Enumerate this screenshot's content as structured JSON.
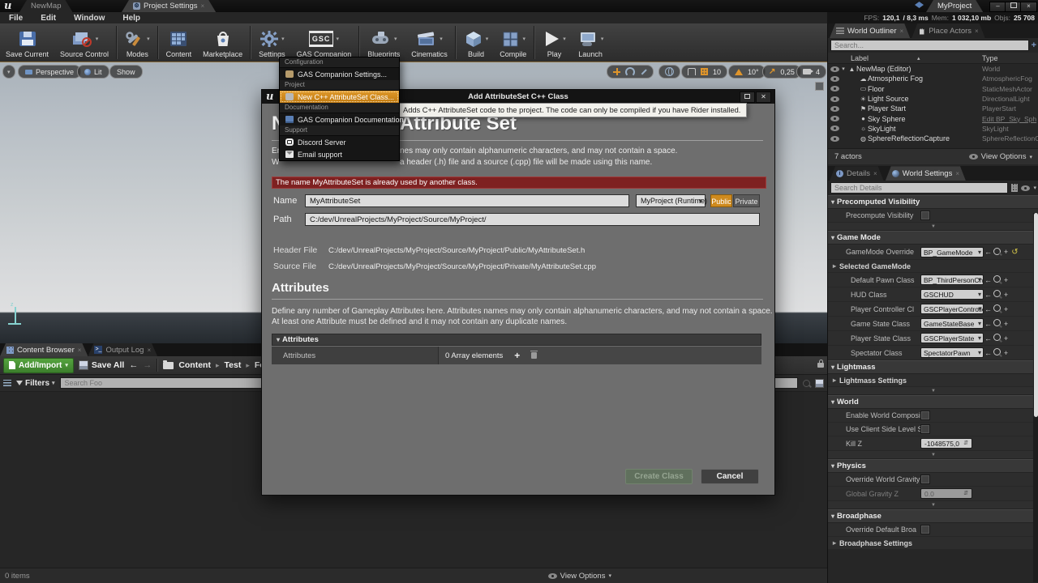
{
  "window": {
    "logo": "u",
    "tabs": [
      {
        "label": "NewMap"
      },
      {
        "label": "Project Settings"
      }
    ],
    "app_title": "MyProject",
    "menu_items": [
      "File",
      "Edit",
      "Window",
      "Help"
    ],
    "stats": {
      "fps_label": "FPS:",
      "fps_value": "120,1",
      "ms_value": "/ 8,3 ms",
      "mem_label": "Mem:",
      "mem_value": "1 032,10 mb",
      "objs_label": "Objs:",
      "objs_value": "25 708"
    }
  },
  "toolbar": {
    "buttons": [
      {
        "label": "Save Current"
      },
      {
        "label": "Source Control"
      },
      {
        "label": "Modes"
      },
      {
        "label": "Content"
      },
      {
        "label": "Marketplace"
      },
      {
        "label": "Settings"
      },
      {
        "label": "GAS Companion",
        "logo": "GSC"
      },
      {
        "label": "Blueprints"
      },
      {
        "label": "Cinematics"
      },
      {
        "label": "Build"
      },
      {
        "label": "Compile"
      },
      {
        "label": "Play"
      },
      {
        "label": "Launch"
      }
    ]
  },
  "viewport": {
    "perspective": "Perspective",
    "lit": "Lit",
    "show": "Show",
    "grid_snap": "10",
    "rotation_snap": "10°",
    "scale_snap": "0,25",
    "camera_speed": "4"
  },
  "gas_menu": {
    "sections": [
      {
        "header": "Configuration",
        "items": [
          {
            "label": "GAS Companion Settings..."
          }
        ]
      },
      {
        "header": "Project",
        "items": [
          {
            "label": "New C++ AttributeSet Class..."
          }
        ]
      },
      {
        "header": "Documentation",
        "items": [
          {
            "label": "GAS Companion Documentation"
          }
        ]
      },
      {
        "header": "Support",
        "items": [
          {
            "label": "Discord Server"
          },
          {
            "label": "Email support"
          }
        ]
      }
    ]
  },
  "dialog": {
    "title": "Add AttributeSet C++ Class",
    "tooltip": "Adds C++ AttributeSet code to the project. The code can only be compiled if you have Rider installed.",
    "heading_start": "N",
    "heading": "Attribute Set",
    "intro_line1_start": "En",
    "intro_line1": "nes may only contain alphanumeric characters, and may not contain a space.",
    "intro_line2_start": "W",
    "intro_line2": "a header (.h) file and a source (.cpp) file will be made using this name.",
    "error": "The name MyAttributeSet is already used by another class.",
    "name_label": "Name",
    "name_value": "MyAttributeSet",
    "module_value": "MyProject (Runtime)",
    "public_label": "Public",
    "private_label": "Private",
    "path_label": "Path",
    "path_value": "C:/dev/UnrealProjects/MyProject/Source/MyProject/",
    "header_file_label": "Header File",
    "header_file_value": "C:/dev/UnrealProjects/MyProject/Source/MyProject/Public/MyAttributeSet.h",
    "source_file_label": "Source File",
    "source_file_value": "C:/dev/UnrealProjects/MyProject/Source/MyProject/Private/MyAttributeSet.cpp",
    "attributes_heading": "Attributes",
    "attributes_desc1": "Define any number of Gameplay Attributes here. Attributes names may only contain alphanumeric characters, and may not contain a space.",
    "attributes_desc2": "At least one Attribute must be defined and it may not contain any duplicate names.",
    "attributes_panel_header": "Attributes",
    "attributes_row_label": "Attributes",
    "attributes_row_value": "0 Array elements",
    "create_label": "Create Class",
    "cancel_label": "Cancel"
  },
  "outliner": {
    "tab_world_outliner": "World Outliner",
    "tab_place_actors": "Place Actors",
    "search_placeholder": "Search...",
    "col_label": "Label",
    "col_type": "Type",
    "rows": [
      {
        "label": "NewMap (Editor)",
        "type": "World"
      },
      {
        "label": "Atmospheric Fog",
        "type": "AtmosphericFog"
      },
      {
        "label": "Floor",
        "type": "StaticMeshActor"
      },
      {
        "label": "Light Source",
        "type": "DirectionalLight"
      },
      {
        "label": "Player Start",
        "type": "PlayerStart"
      },
      {
        "label": "Sky Sphere",
        "type": "Edit BP_Sky_Sph"
      },
      {
        "label": "SkyLight",
        "type": "SkyLight"
      },
      {
        "label": "SphereReflectionCapture",
        "type": "SphereReflectionC"
      }
    ],
    "footer_count": "7 actors",
    "view_options": "View Options"
  },
  "details": {
    "tab_details": "Details",
    "tab_world_settings": "World Settings",
    "search_placeholder": "Search Details",
    "precomputed_header": "Precomputed Visibility",
    "precompute_row": "Precompute Visibility",
    "game_mode_header": "Game Mode",
    "gamemode_override_label": "GameMode Override",
    "gamemode_override_value": "BP_GameMode",
    "selected_gamemode": "Selected GameMode",
    "gm_rows": [
      {
        "label": "Default Pawn Class",
        "value": "BP_ThirdPersonChar"
      },
      {
        "label": "HUD Class",
        "value": "GSCHUD"
      },
      {
        "label": "Player Controller Cl",
        "value": "GSCPlayerController"
      },
      {
        "label": "Game State Class",
        "value": "GameStateBase"
      },
      {
        "label": "Player State Class",
        "value": "GSCPlayerState"
      },
      {
        "label": "Spectator Class",
        "value": "SpectatorPawn"
      }
    ],
    "lightmass_header": "Lightmass",
    "lightmass_settings": "Lightmass Settings",
    "world_header": "World",
    "world_row1": "Enable World Composi",
    "world_row2": "Use Client Side Level S",
    "world_row3_label": "Kill Z",
    "world_row3_value": "-1048575,0",
    "physics_header": "Physics",
    "physics_row1": "Override World Gravity",
    "physics_row2_label": "Global Gravity Z",
    "physics_row2_value": "0.0",
    "broadphase_header": "Broadphase",
    "broadphase_row1": "Override Default Broa",
    "broadphase_settings": "Broadphase Settings"
  },
  "content_browser": {
    "tab_content_browser": "Content Browser",
    "tab_output_log": "Output Log",
    "add_import": "Add/Import",
    "save_all": "Save All",
    "breadcrumbs": [
      "Content",
      "Test",
      "Foo"
    ],
    "filters": "Filters",
    "search_placeholder": "Search Foo",
    "items_count": "0 items",
    "view_options": "View Options"
  },
  "colors": {
    "accent_orange": "#d6901e",
    "add_import_green": "#4a9a38",
    "error_red": "#7e2121",
    "link_blue": "#86aee0"
  }
}
